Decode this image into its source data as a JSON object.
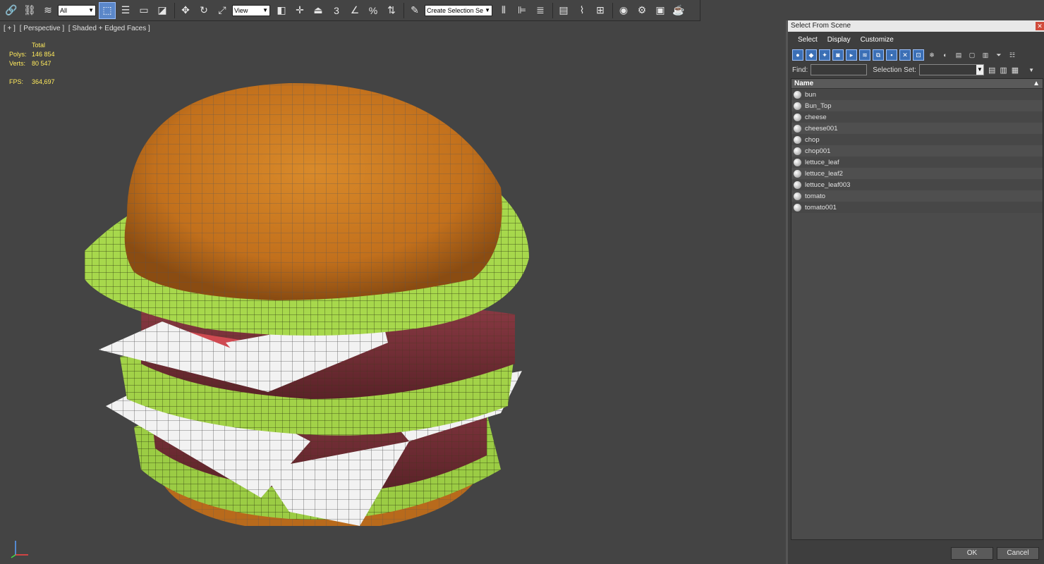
{
  "toolbar": {
    "filter_dropdown": "All",
    "refcoord_dropdown": "View",
    "selection_set_placeholder": "Create Selection Se",
    "snap_label": "3"
  },
  "viewport": {
    "labels": [
      "[ + ]",
      "[ Perspective ]",
      "[ Shaded + Edged Faces ]"
    ],
    "stats": {
      "total_label": "Total",
      "polys_label": "Polys:",
      "polys_value": "146 854",
      "verts_label": "Verts:",
      "verts_value": "80 547",
      "fps_label": "FPS:",
      "fps_value": "364,697"
    }
  },
  "dialog": {
    "title": "Select From Scene",
    "menu": [
      "Select",
      "Display",
      "Customize"
    ],
    "find_label": "Find:",
    "selection_set_label": "Selection Set:",
    "column_name": "Name",
    "items": [
      "bun",
      "Bun_Top",
      "cheese",
      "cheese001",
      "chop",
      "chop001",
      "lettuce_leaf",
      "lettuce_leaf2",
      "lettuce_leaf003",
      "tomato",
      "tomato001"
    ],
    "ok_label": "OK",
    "cancel_label": "Cancel"
  },
  "colors": {
    "accent": "#5b87c9",
    "stats_text": "#ffea5c",
    "viewport_bg": "#444444"
  }
}
